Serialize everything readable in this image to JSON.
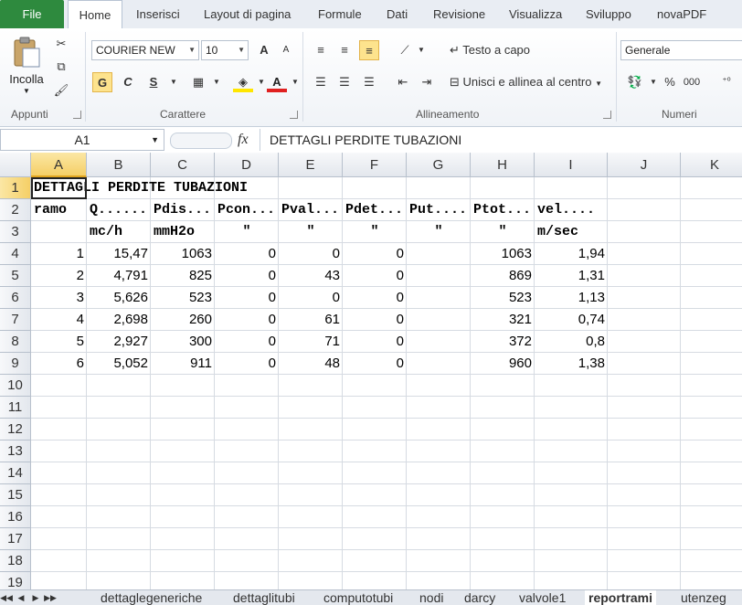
{
  "ribbon": {
    "tabs": [
      "File",
      "Home",
      "Inserisci",
      "Layout di pagina",
      "Formule",
      "Dati",
      "Revisione",
      "Visualizza",
      "Sviluppo",
      "novaPDF"
    ],
    "clipboard": {
      "paste_label": "Incolla",
      "group_label": "Appunti"
    },
    "font": {
      "name": "COURIER NEW",
      "size": "10",
      "bold": "G",
      "italic": "C",
      "underline": "S",
      "group_label": "Carattere",
      "grow": "A",
      "shrink": "A",
      "fontcolor": "A"
    },
    "alignment": {
      "wrap_text": "Testo a capo",
      "merge_center": "Unisci e allinea al centro",
      "group_label": "Allineamento"
    },
    "number": {
      "format": "Generale",
      "percent": "%",
      "thousands": "000",
      "group_label": "Numeri"
    }
  },
  "formula_bar": {
    "name_box": "A1",
    "fx": "fx",
    "content": "DETTAGLI PERDITE TUBAZIONI"
  },
  "sheet": {
    "columns": [
      "A",
      "B",
      "C",
      "D",
      "E",
      "F",
      "G",
      "H",
      "I",
      "J",
      "K"
    ],
    "rows": [
      "1",
      "2",
      "3",
      "4",
      "5",
      "6",
      "7",
      "8",
      "9",
      "10",
      "11",
      "12",
      "13",
      "14",
      "15",
      "16",
      "17",
      "18",
      "19"
    ],
    "title": "DETTAGLI PERDITE TUBAZIONI",
    "headers": [
      "ramo",
      "Q......",
      "Pdis...",
      "Pcon...",
      "Pval...",
      "Pdet...",
      "Put....",
      "Ptot...",
      "vel...."
    ],
    "units": [
      "",
      "mc/h",
      "mmH2o",
      "\"",
      "\"",
      "\"",
      "\"",
      "\"",
      "m/sec"
    ],
    "data": [
      [
        "1",
        "15,47",
        "1063",
        "0",
        "0",
        "0",
        "",
        "1063",
        "1,94"
      ],
      [
        "2",
        "4,791",
        "825",
        "0",
        "43",
        "0",
        "",
        "869",
        "1,31"
      ],
      [
        "3",
        "5,626",
        "523",
        "0",
        "0",
        "0",
        "",
        "523",
        "1,13"
      ],
      [
        "4",
        "2,698",
        "260",
        "0",
        "61",
        "0",
        "",
        "321",
        "0,74"
      ],
      [
        "5",
        "2,927",
        "300",
        "0",
        "71",
        "0",
        "",
        "372",
        "0,8"
      ],
      [
        "6",
        "5,052",
        "911",
        "0",
        "48",
        "0",
        "",
        "960",
        "1,38"
      ]
    ]
  },
  "sheet_tabs": {
    "nav": [
      "◀◀",
      "◀",
      "▶",
      "▶▶"
    ],
    "tabs": [
      "dettaglegeneriche",
      "dettaglitubi",
      "computotubi",
      "nodi",
      "darcy",
      "valvole1",
      "reportrami",
      "utenzeg"
    ],
    "active": "reportrami"
  }
}
